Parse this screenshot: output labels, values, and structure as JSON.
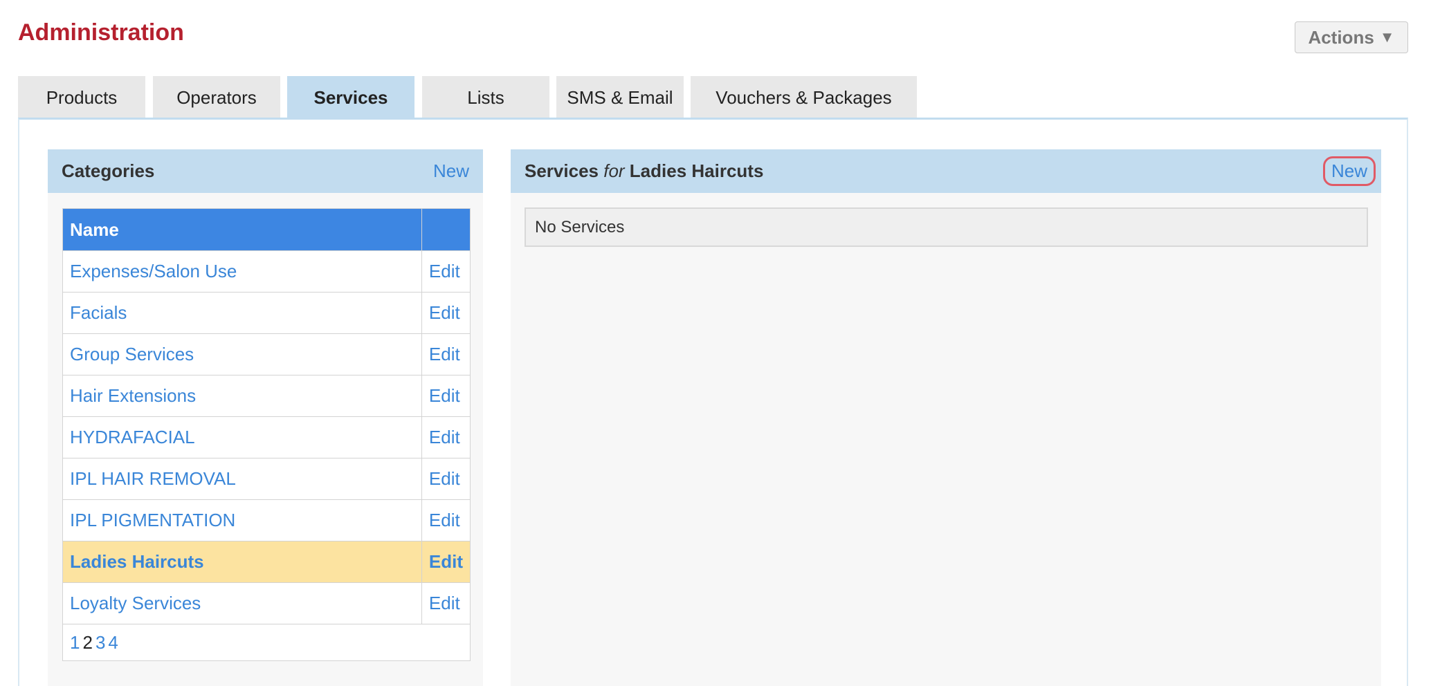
{
  "page": {
    "title": "Administration"
  },
  "actions": {
    "label": "Actions",
    "icon": "caret-down-icon",
    "caret": "▼"
  },
  "tabs": [
    {
      "label": "Products"
    },
    {
      "label": "Operators"
    },
    {
      "label": "Services",
      "active": true
    },
    {
      "label": "Lists"
    },
    {
      "label": "SMS & Email"
    },
    {
      "label": "Vouchers & Packages"
    }
  ],
  "categories": {
    "title": "Categories",
    "new_label": "New",
    "column_name": "Name",
    "rows": [
      {
        "name": "Expenses/Salon Use",
        "edit": "Edit"
      },
      {
        "name": "Facials",
        "edit": "Edit"
      },
      {
        "name": "Group Services",
        "edit": "Edit"
      },
      {
        "name": "Hair Extensions",
        "edit": "Edit"
      },
      {
        "name": "HYDRAFACIAL",
        "edit": "Edit"
      },
      {
        "name": "IPL HAIR REMOVAL",
        "edit": "Edit"
      },
      {
        "name": "IPL PIGMENTATION",
        "edit": "Edit"
      },
      {
        "name": "Ladies Haircuts",
        "edit": "Edit",
        "selected": true
      },
      {
        "name": "Loyalty Services",
        "edit": "Edit"
      }
    ],
    "pages": [
      "1",
      "2",
      "3",
      "4"
    ],
    "current_page": "2"
  },
  "services": {
    "title_prefix": "Services",
    "title_for": "for",
    "category_name": "Ladies Haircuts",
    "new_label": "New",
    "empty_text": "No Services"
  },
  "colors": {
    "title_red": "#b5202e",
    "header_blue": "#c2dcef",
    "table_header": "#3d86e2",
    "link": "#3a86d8",
    "selected_row": "#fce3a0",
    "highlight_ring": "#e05a66"
  }
}
